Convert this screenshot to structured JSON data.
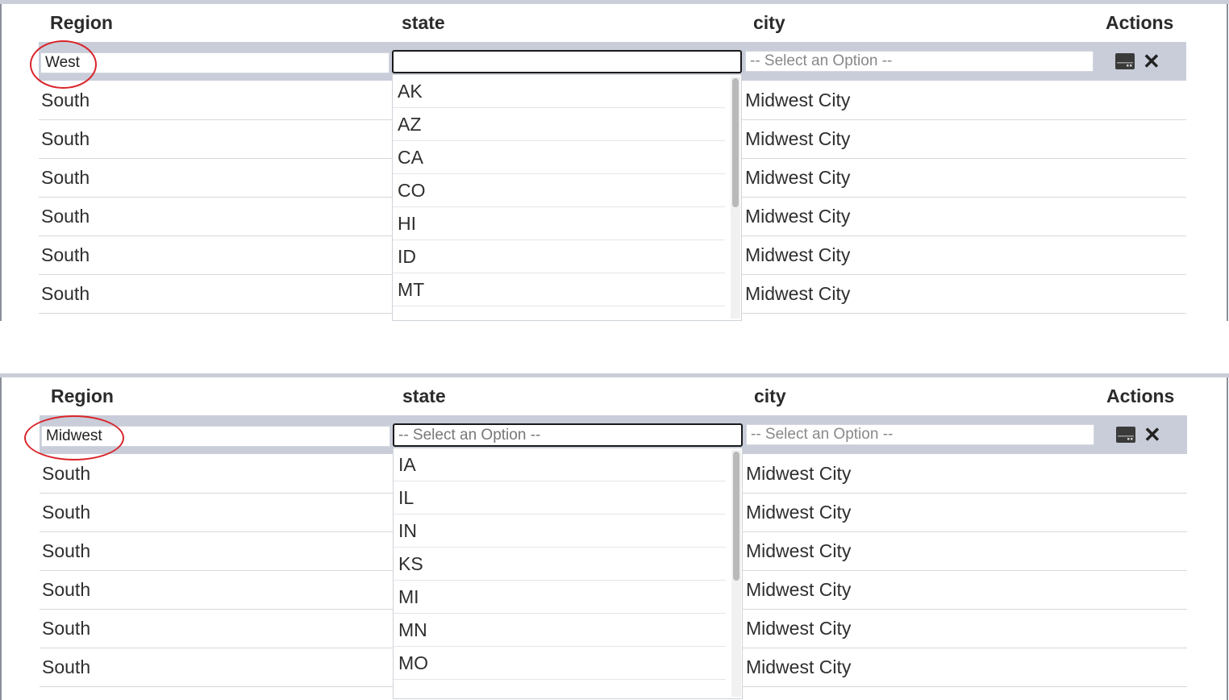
{
  "columns": {
    "region": "Region",
    "state": "state",
    "city": "city",
    "actions": "Actions"
  },
  "top": {
    "edit_row": {
      "region_value": "West",
      "state_value": "",
      "city_placeholder": "-- Select an Option --"
    },
    "rows": [
      {
        "region": "South",
        "city": "Midwest City"
      },
      {
        "region": "South",
        "city": "Midwest City"
      },
      {
        "region": "South",
        "city": "Midwest City"
      },
      {
        "region": "South",
        "city": "Midwest City"
      },
      {
        "region": "South",
        "city": "Midwest City"
      },
      {
        "region": "South",
        "city": "Midwest City"
      }
    ],
    "dropdown_options": [
      "AK",
      "AZ",
      "CA",
      "CO",
      "HI",
      "ID",
      "MT"
    ]
  },
  "bottom": {
    "edit_row": {
      "region_value": "Midwest",
      "state_placeholder": "-- Select an Option --",
      "city_placeholder": "-- Select an Option --"
    },
    "rows": [
      {
        "region": "South",
        "city": "Midwest City"
      },
      {
        "region": "South",
        "city": "Midwest City"
      },
      {
        "region": "South",
        "city": "Midwest City"
      },
      {
        "region": "South",
        "city": "Midwest City"
      },
      {
        "region": "South",
        "city": "Midwest City"
      },
      {
        "region": "South",
        "city": "Midwest City"
      }
    ],
    "dropdown_options": [
      "IA",
      "IL",
      "IN",
      "KS",
      "MI",
      "MN",
      "MO"
    ]
  },
  "icons": {
    "save": "save-icon",
    "cancel": "close-icon"
  },
  "colors": {
    "edit_row_bg": "#c8cdd9",
    "highlight_circle": "#d9242a",
    "focus_border": "#1a1a1a"
  }
}
